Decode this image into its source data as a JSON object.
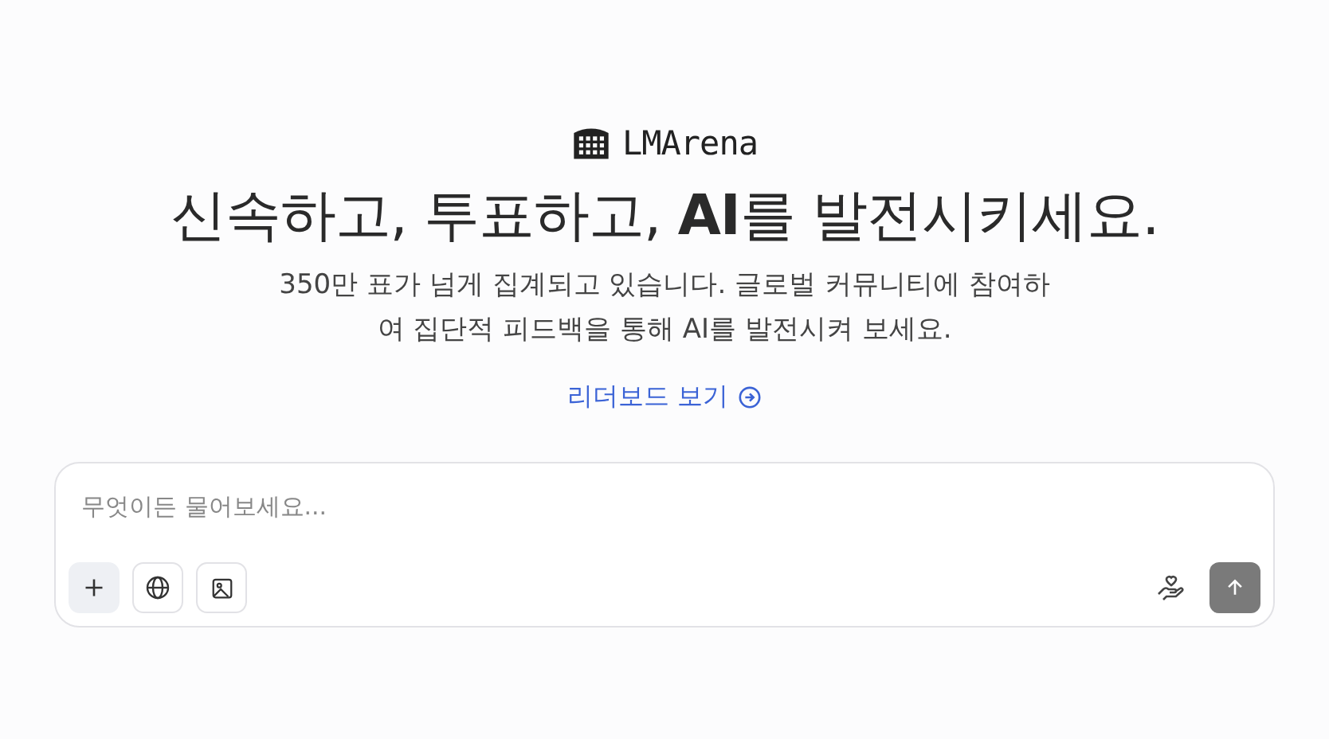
{
  "brand": {
    "name": "LMArena"
  },
  "headline": "신속하고, 투표하고, **AI**를 발전시키세요.",
  "subtitle": "350만 표가 넘게 집계되고 있습니다. 글로벌 커뮤니티에 참여하여 집단적 피드백을 통해 AI를 발전시켜 보세요.",
  "leaderboard_link": "리더보드 보기",
  "prompt": {
    "placeholder": "무엇이든 물어보세요...",
    "send_disabled": true
  }
}
